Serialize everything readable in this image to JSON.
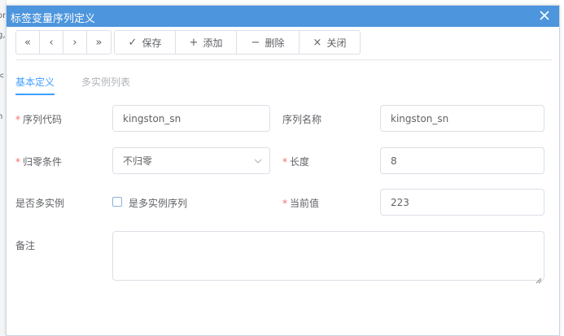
{
  "background": {
    "fragments": [
      "on",
      "g,",
      "<",
      "n"
    ]
  },
  "dialog": {
    "title": "标签变量序列定义"
  },
  "toolbar": {
    "pager": {
      "first": "«",
      "prev": "‹",
      "next": "›",
      "last": "»"
    },
    "save": {
      "icon": "✓",
      "label": "保存"
    },
    "add": {
      "icon": "+",
      "label": "添加"
    },
    "delete": {
      "icon": "−",
      "label": "删除"
    },
    "close": {
      "icon": "×",
      "label": "关闭"
    }
  },
  "tabs": [
    {
      "label": "基本定义",
      "active": true
    },
    {
      "label": "多实例列表",
      "active": false
    }
  ],
  "form": {
    "seq_code": {
      "label": "序列代码",
      "required": "*",
      "value": "kingston_sn"
    },
    "seq_name": {
      "label": "序列名称",
      "value": "kingston_sn"
    },
    "reset_cond": {
      "label": "归零条件",
      "required": "*",
      "value": "不归零"
    },
    "length": {
      "label": "长度",
      "required": "*",
      "value": "8"
    },
    "multi_instance": {
      "label": "是否多实例",
      "checkbox_label": "是多实例序列",
      "checked": false
    },
    "current_value": {
      "label": "当前值",
      "required": "*",
      "value": "223"
    },
    "remark": {
      "label": "备注",
      "value": ""
    }
  },
  "colors": {
    "titlebar": "#4d95dc",
    "accent": "#409eff",
    "required": "#f56c6c",
    "text": "#606266"
  }
}
